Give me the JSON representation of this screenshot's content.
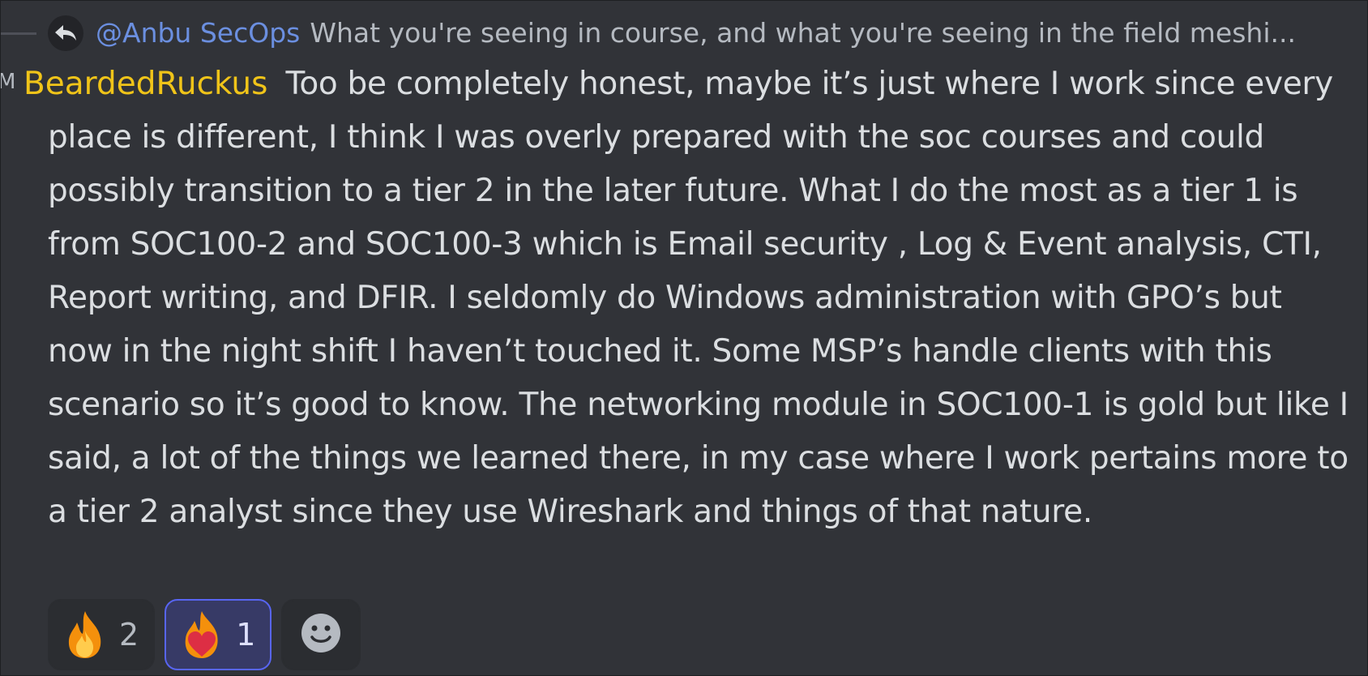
{
  "reply": {
    "mention": "@Anbu SecOps",
    "preview": "What you're seeing in course, and what you're seeing in the field meshi..."
  },
  "message": {
    "edge_initial": "M",
    "author": "BeardedRuckus",
    "text": "Too be completely honest, maybe it’s just where I work since every place is different, I think I was overly prepared with the soc courses and could possibly transition to a tier 2 in the later future. What I do the most as a tier 1 is from SOC100-2 and SOC100-3 which is Email security , Log & Event analysis, CTI, Report writing, and DFIR. I seldomly do Windows administration with GPO’s but now in the night shift I haven’t touched it. Some MSP’s handle clients with this scenario so it’s good to know. The networking module in SOC100-1 is gold but like I said, a lot of the things we learned there, in my case where I work pertains more to a tier 2 analyst since they use Wireshark and things of that nature."
  },
  "reactions": [
    {
      "icon": "fire-emoji-icon",
      "count": "2",
      "active": false
    },
    {
      "icon": "heart-on-fire-emoji-icon",
      "count": "1",
      "active": true
    }
  ],
  "add_reaction": {
    "icon": "add-reaction-smiley-icon"
  },
  "colors": {
    "background": "#313338",
    "author": "#f0c419",
    "mention": "#6b8fe0",
    "body_text": "#dbdee1",
    "active_reaction_border": "#5865f2"
  }
}
